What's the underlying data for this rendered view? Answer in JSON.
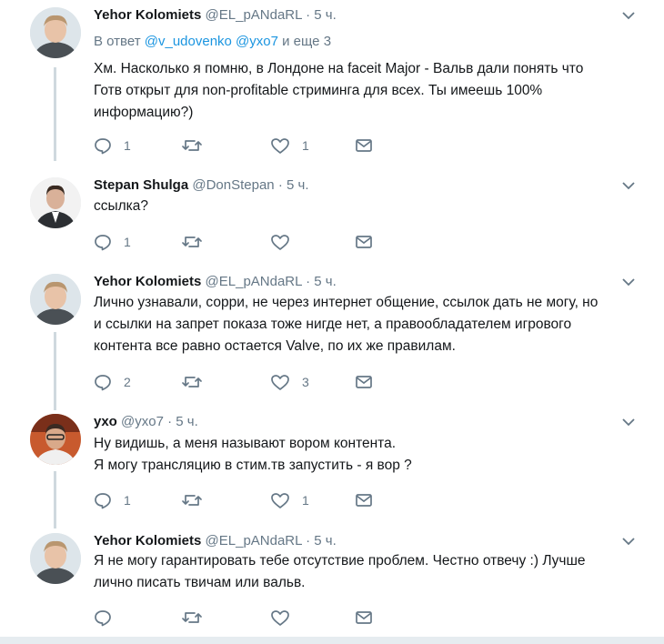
{
  "tweets": [
    {
      "name": "Yehor Kolomiets",
      "handle": "@EL_pANdaRL",
      "dot": "·",
      "time": "5 ч.",
      "reply_prefix": "В ответ",
      "reply_users": "@v_udovenko @yxo7",
      "reply_suffix": "и еще 3",
      "lines": [
        "Хм. Насколько я помню, в Лондоне на faceit Major - Вальв дали понять что",
        "Готв открыт для non-profitable стриминга для всех. Ты имеешь 100%",
        "информацию?)"
      ],
      "reply_count": "1",
      "retweet_count": "",
      "like_count": "1"
    },
    {
      "name": "Stepan Shulga",
      "handle": "@DonStepan",
      "dot": "·",
      "time": "5 ч.",
      "lines": [
        "ссылка?"
      ],
      "reply_count": "1",
      "retweet_count": "",
      "like_count": ""
    },
    {
      "name": "Yehor Kolomiets",
      "handle": "@EL_pANdaRL",
      "dot": "·",
      "time": "5 ч.",
      "lines": [
        "Лично узнавали, сорри, не через интернет общение, ссылок дать не могу, но",
        "и ссылки на запрет показа тоже нигде нет, а правообладателем игрового",
        "контента все равно остается Valve, по их же правилам."
      ],
      "reply_count": "2",
      "retweet_count": "",
      "like_count": "3"
    },
    {
      "name": "yxo",
      "handle": "@yxo7",
      "dot": "·",
      "time": "5 ч.",
      "lines": [
        "Ну видишь, а меня называют вором контента.",
        "Я могу трансляцию в стим.тв запустить - я вор ?"
      ],
      "reply_count": "1",
      "retweet_count": "",
      "like_count": "1"
    },
    {
      "name": "Yehor Kolomiets",
      "handle": "@EL_pANdaRL",
      "dot": "·",
      "time": "5 ч.",
      "lines": [
        "Я не могу гарантировать тебе отсутствие проблем. Честно отвечу :) Лучше",
        "лично писать твичам или вальв."
      ],
      "reply_count": "",
      "retweet_count": "",
      "like_count": ""
    }
  ],
  "colors": {
    "accent": "#1b95e0",
    "secondary_text": "#657786",
    "thread_line": "#cfd9de",
    "icon": "#657786"
  },
  "icons": {
    "reply": "reply-icon",
    "retweet": "retweet-icon",
    "like": "heart-icon",
    "dm": "envelope-icon",
    "more": "chevron-down-icon"
  }
}
